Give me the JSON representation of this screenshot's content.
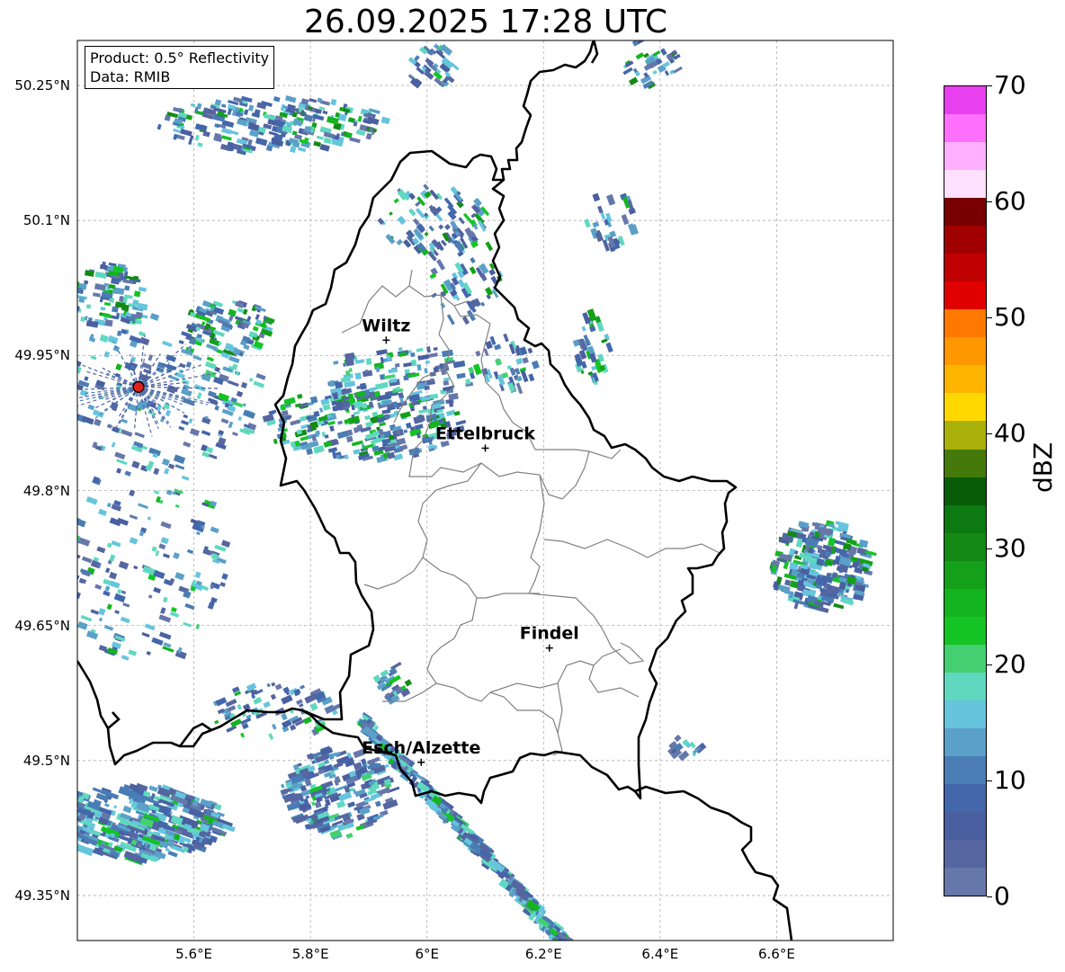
{
  "title": "26.09.2025 17:28 UTC",
  "info": {
    "product": "Product: 0.5° Reflectivity",
    "data": "Data: RMIB"
  },
  "axes": {
    "y_ticks": [
      "50.25°N",
      "50.1°N",
      "49.95°N",
      "49.8°N",
      "49.65°N",
      "49.5°N",
      "49.35°N"
    ],
    "x_ticks": [
      "5.6°E",
      "5.8°E",
      "6°E",
      "6.2°E",
      "6.4°E",
      "6.6°E"
    ],
    "extent": {
      "lon_min": 5.4,
      "lon_max": 6.8,
      "lat_min": 49.3,
      "lat_max": 50.3
    }
  },
  "cities": [
    {
      "name": "Wiltz",
      "lon": 5.93,
      "lat": 49.967
    },
    {
      "name": "Ettelbruck",
      "lon": 6.1,
      "lat": 49.847
    },
    {
      "name": "Findel",
      "lon": 6.21,
      "lat": 49.625
    },
    {
      "name": "Esch/Alzette",
      "lon": 5.99,
      "lat": 49.498
    }
  ],
  "radar_site": {
    "lon": 5.505,
    "lat": 49.915
  },
  "colorbar": {
    "label": "dBZ",
    "ticks": [
      "0",
      "10",
      "20",
      "30",
      "40",
      "50",
      "60",
      "70"
    ],
    "colors": [
      "#6677aa",
      "#5566a0",
      "#4a5fa0",
      "#4466aa",
      "#4a7db3",
      "#5aa0c8",
      "#66c4dd",
      "#60d8c0",
      "#44d070",
      "#14c424",
      "#14b420",
      "#14a018",
      "#148a14",
      "#0c7a10",
      "#085c08",
      "#447a0a",
      "#aab00a",
      "#ffd800",
      "#ffb400",
      "#ff9800",
      "#ff7800",
      "#e00000",
      "#c00000",
      "#a00000",
      "#780000",
      "#ffe0ff",
      "#ffb0ff",
      "#ff70ff",
      "#e840ee"
    ]
  },
  "colors": {
    "border": "#000000",
    "canton": "#808080",
    "grid": "#b0b0b0",
    "radar_marker": "#e02020"
  }
}
